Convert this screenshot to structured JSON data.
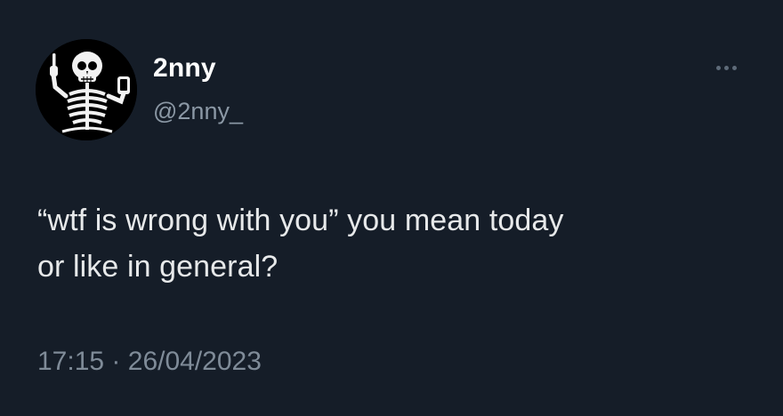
{
  "author": {
    "display_name": "2nny",
    "handle": "@2nny_",
    "avatar_icon": "skeleton-middle-finger-avatar"
  },
  "menu": {
    "icon": "more-horizontal-icon"
  },
  "tweet": {
    "text": "“wtf is wrong with you” you mean today\nor like in general?",
    "time": "17:15",
    "separator": "·",
    "date": "26/04/2023"
  },
  "colors": {
    "background": "#151d28",
    "primary_text": "#e7e9ea",
    "secondary_text": "#8b98a5"
  }
}
